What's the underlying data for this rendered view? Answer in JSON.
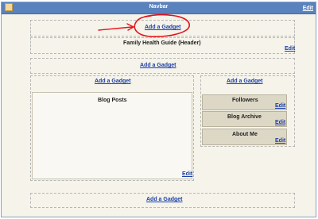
{
  "navbar": {
    "title": "Navbar",
    "edit_label": "Edit"
  },
  "top_slot": {
    "add_gadget_label": "Add a Gadget"
  },
  "header": {
    "title": "Family Health Guide (Header)",
    "edit_label": "Edit"
  },
  "crosscolumn": {
    "add_gadget_label": "Add a Gadget"
  },
  "main": {
    "add_gadget_label": "Add a Gadget",
    "blog_posts_label": "Blog Posts",
    "edit_label": "Edit"
  },
  "sidebar": {
    "add_gadget_label": "Add a Gadget",
    "gadgets": [
      {
        "title": "Followers",
        "edit_label": "Edit"
      },
      {
        "title": "Blog Archive",
        "edit_label": "Edit"
      },
      {
        "title": "About Me",
        "edit_label": "Edit"
      }
    ]
  },
  "footer": {
    "add_gadget_label": "Add a Gadget"
  },
  "colors": {
    "navbar_bg": "#5a82bd",
    "link": "#1a3ea5",
    "annotation": "#e4121b"
  }
}
